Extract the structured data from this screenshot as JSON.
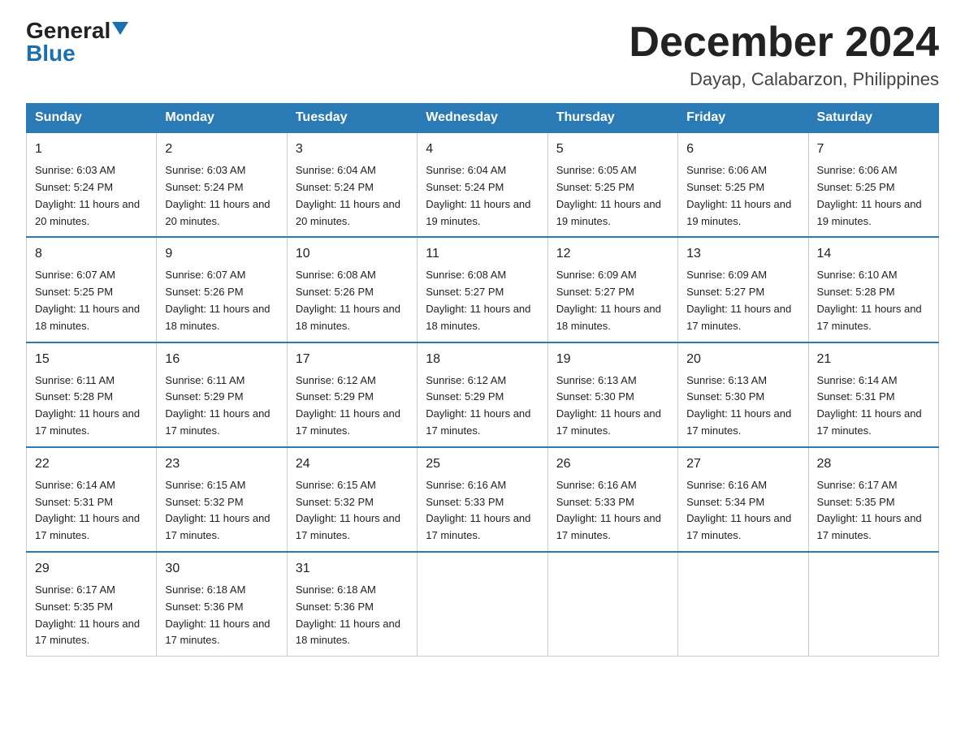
{
  "header": {
    "logo_general": "General",
    "logo_blue": "Blue",
    "title": "December 2024",
    "location": "Dayap, Calabarzon, Philippines"
  },
  "weekdays": [
    "Sunday",
    "Monday",
    "Tuesday",
    "Wednesday",
    "Thursday",
    "Friday",
    "Saturday"
  ],
  "weeks": [
    [
      {
        "day": "1",
        "sunrise": "6:03 AM",
        "sunset": "5:24 PM",
        "daylight": "11 hours and 20 minutes."
      },
      {
        "day": "2",
        "sunrise": "6:03 AM",
        "sunset": "5:24 PM",
        "daylight": "11 hours and 20 minutes."
      },
      {
        "day": "3",
        "sunrise": "6:04 AM",
        "sunset": "5:24 PM",
        "daylight": "11 hours and 20 minutes."
      },
      {
        "day": "4",
        "sunrise": "6:04 AM",
        "sunset": "5:24 PM",
        "daylight": "11 hours and 19 minutes."
      },
      {
        "day": "5",
        "sunrise": "6:05 AM",
        "sunset": "5:25 PM",
        "daylight": "11 hours and 19 minutes."
      },
      {
        "day": "6",
        "sunrise": "6:06 AM",
        "sunset": "5:25 PM",
        "daylight": "11 hours and 19 minutes."
      },
      {
        "day": "7",
        "sunrise": "6:06 AM",
        "sunset": "5:25 PM",
        "daylight": "11 hours and 19 minutes."
      }
    ],
    [
      {
        "day": "8",
        "sunrise": "6:07 AM",
        "sunset": "5:25 PM",
        "daylight": "11 hours and 18 minutes."
      },
      {
        "day": "9",
        "sunrise": "6:07 AM",
        "sunset": "5:26 PM",
        "daylight": "11 hours and 18 minutes."
      },
      {
        "day": "10",
        "sunrise": "6:08 AM",
        "sunset": "5:26 PM",
        "daylight": "11 hours and 18 minutes."
      },
      {
        "day": "11",
        "sunrise": "6:08 AM",
        "sunset": "5:27 PM",
        "daylight": "11 hours and 18 minutes."
      },
      {
        "day": "12",
        "sunrise": "6:09 AM",
        "sunset": "5:27 PM",
        "daylight": "11 hours and 18 minutes."
      },
      {
        "day": "13",
        "sunrise": "6:09 AM",
        "sunset": "5:27 PM",
        "daylight": "11 hours and 17 minutes."
      },
      {
        "day": "14",
        "sunrise": "6:10 AM",
        "sunset": "5:28 PM",
        "daylight": "11 hours and 17 minutes."
      }
    ],
    [
      {
        "day": "15",
        "sunrise": "6:11 AM",
        "sunset": "5:28 PM",
        "daylight": "11 hours and 17 minutes."
      },
      {
        "day": "16",
        "sunrise": "6:11 AM",
        "sunset": "5:29 PM",
        "daylight": "11 hours and 17 minutes."
      },
      {
        "day": "17",
        "sunrise": "6:12 AM",
        "sunset": "5:29 PM",
        "daylight": "11 hours and 17 minutes."
      },
      {
        "day": "18",
        "sunrise": "6:12 AM",
        "sunset": "5:29 PM",
        "daylight": "11 hours and 17 minutes."
      },
      {
        "day": "19",
        "sunrise": "6:13 AM",
        "sunset": "5:30 PM",
        "daylight": "11 hours and 17 minutes."
      },
      {
        "day": "20",
        "sunrise": "6:13 AM",
        "sunset": "5:30 PM",
        "daylight": "11 hours and 17 minutes."
      },
      {
        "day": "21",
        "sunrise": "6:14 AM",
        "sunset": "5:31 PM",
        "daylight": "11 hours and 17 minutes."
      }
    ],
    [
      {
        "day": "22",
        "sunrise": "6:14 AM",
        "sunset": "5:31 PM",
        "daylight": "11 hours and 17 minutes."
      },
      {
        "day": "23",
        "sunrise": "6:15 AM",
        "sunset": "5:32 PM",
        "daylight": "11 hours and 17 minutes."
      },
      {
        "day": "24",
        "sunrise": "6:15 AM",
        "sunset": "5:32 PM",
        "daylight": "11 hours and 17 minutes."
      },
      {
        "day": "25",
        "sunrise": "6:16 AM",
        "sunset": "5:33 PM",
        "daylight": "11 hours and 17 minutes."
      },
      {
        "day": "26",
        "sunrise": "6:16 AM",
        "sunset": "5:33 PM",
        "daylight": "11 hours and 17 minutes."
      },
      {
        "day": "27",
        "sunrise": "6:16 AM",
        "sunset": "5:34 PM",
        "daylight": "11 hours and 17 minutes."
      },
      {
        "day": "28",
        "sunrise": "6:17 AM",
        "sunset": "5:35 PM",
        "daylight": "11 hours and 17 minutes."
      }
    ],
    [
      {
        "day": "29",
        "sunrise": "6:17 AM",
        "sunset": "5:35 PM",
        "daylight": "11 hours and 17 minutes."
      },
      {
        "day": "30",
        "sunrise": "6:18 AM",
        "sunset": "5:36 PM",
        "daylight": "11 hours and 17 minutes."
      },
      {
        "day": "31",
        "sunrise": "6:18 AM",
        "sunset": "5:36 PM",
        "daylight": "11 hours and 18 minutes."
      },
      null,
      null,
      null,
      null
    ]
  ]
}
